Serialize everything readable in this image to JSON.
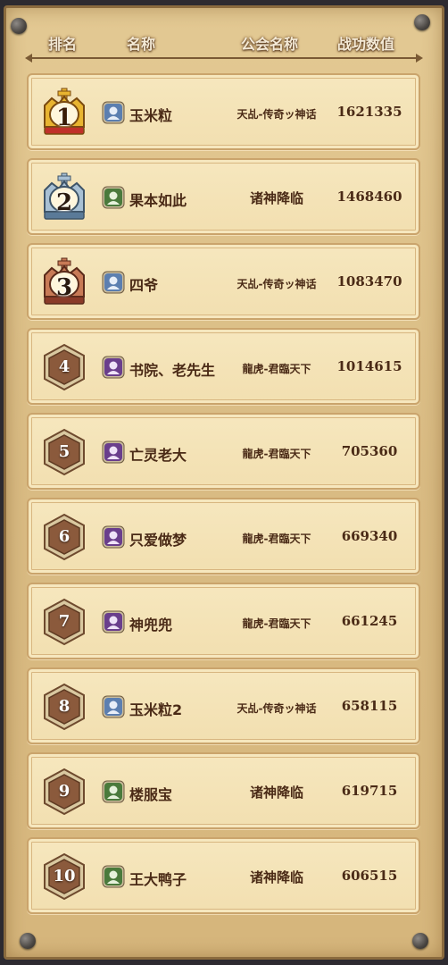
{
  "header": {
    "rank": "排名",
    "name": "名称",
    "guild": "公会名称",
    "score": "战功数值"
  },
  "colors": {
    "parchment": "#e3c993",
    "row_bg": "#f4e3b6",
    "text_brown": "#4a2a16",
    "gold": "#e0a828",
    "silver": "#8aa8c0",
    "bronze": "#c06a48",
    "hex_badge": "#8b5a3c",
    "class_blue": "#5c7fb0",
    "class_green": "#4a7a3c",
    "class_purple": "#6a3e8c"
  },
  "rows": [
    {
      "rank": "1",
      "badge": "gold-crown-icon",
      "class_icon": "mage-class-icon",
      "name": "玉米粒",
      "guild": "天乩-传奇ッ神话",
      "score": "1621335"
    },
    {
      "rank": "2",
      "badge": "silver-crown-icon",
      "class_icon": "warrior-class-icon",
      "name": "果本如此",
      "guild": "诸神降临",
      "score": "1468460"
    },
    {
      "rank": "3",
      "badge": "bronze-crown-icon",
      "class_icon": "mage-class-icon",
      "name": "四爷",
      "guild": "天乩-传奇ッ神话",
      "score": "1083470"
    },
    {
      "rank": "4",
      "badge": "hexagon-badge-icon",
      "class_icon": "taoist-class-icon",
      "name": "书院、老先生",
      "guild": "龍虎-君臨天下",
      "score": "1014615"
    },
    {
      "rank": "5",
      "badge": "hexagon-badge-icon",
      "class_icon": "taoist-class-icon",
      "name": "亡灵老大",
      "guild": "龍虎-君臨天下",
      "score": "705360"
    },
    {
      "rank": "6",
      "badge": "hexagon-badge-icon",
      "class_icon": "taoist-class-icon",
      "name": "只爱做梦",
      "guild": "龍虎-君臨天下",
      "score": "669340"
    },
    {
      "rank": "7",
      "badge": "hexagon-badge-icon",
      "class_icon": "taoist-class-icon",
      "name": "神兜兜",
      "guild": "龍虎-君臨天下",
      "score": "661245"
    },
    {
      "rank": "8",
      "badge": "hexagon-badge-icon",
      "class_icon": "mage-class-icon",
      "name": "玉米粒2",
      "guild": "天乩-传奇ッ神话",
      "score": "658115"
    },
    {
      "rank": "9",
      "badge": "hexagon-badge-icon",
      "class_icon": "warrior-class-icon",
      "name": "楼服宝",
      "guild": "诸神降临",
      "score": "619715"
    },
    {
      "rank": "10",
      "badge": "hexagon-badge-icon",
      "class_icon": "warrior-class-icon",
      "name": "王大鸭子",
      "guild": "诸神降临",
      "score": "606515"
    }
  ]
}
